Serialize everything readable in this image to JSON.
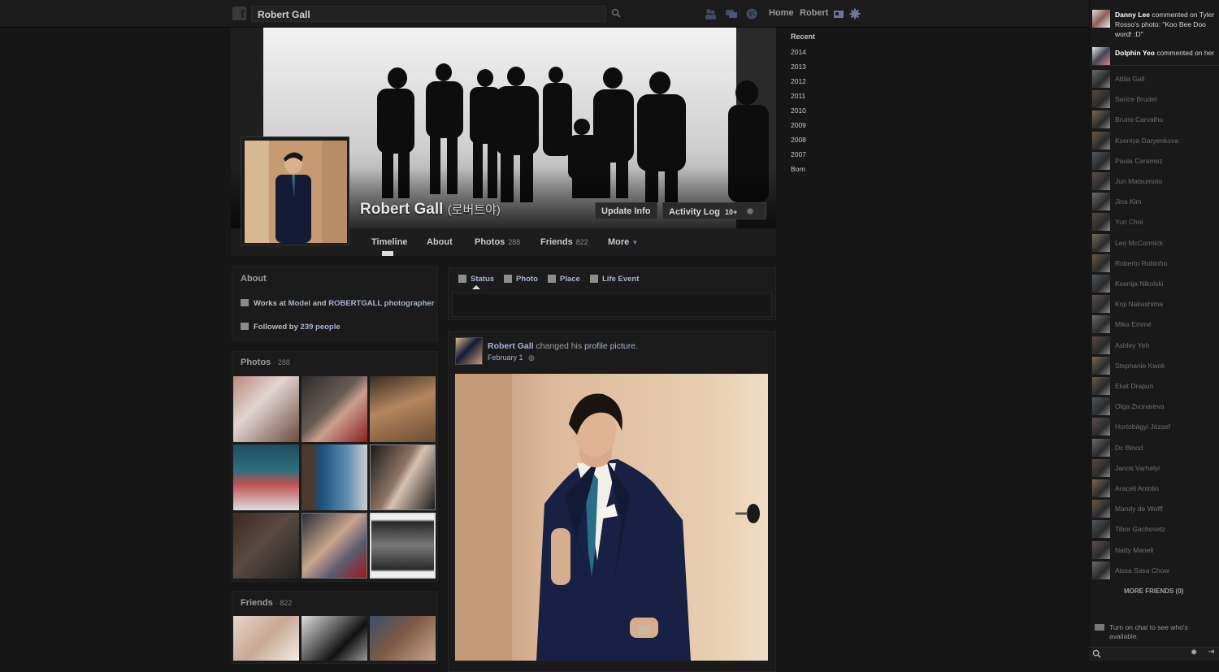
{
  "topbar": {
    "search_value": "Robert Gall",
    "links": [
      "Home",
      "Robert"
    ]
  },
  "cover": {
    "name": "Robert Gall",
    "alt_name": "(로버트야)",
    "update_info": "Update Info",
    "activity_log": "Activity Log",
    "activity_count": "10+"
  },
  "tabs": [
    {
      "label": "Timeline",
      "count": ""
    },
    {
      "label": "About",
      "count": ""
    },
    {
      "label": "Photos",
      "count": "288"
    },
    {
      "label": "Friends",
      "count": "822"
    },
    {
      "label": "More",
      "count": ""
    }
  ],
  "about": {
    "title": "About",
    "works_prefix": "Works at",
    "works_a": "Model",
    "works_and": "and",
    "works_b": "ROBERTGALL photographer",
    "followed_prefix": "Followed by",
    "followed_count": "239 people"
  },
  "photos": {
    "title": "Photos",
    "count": "· 288"
  },
  "friends": {
    "title": "Friends",
    "count": "· 822"
  },
  "composer": {
    "tabs": [
      "Status",
      "Photo",
      "Place",
      "Life Event"
    ]
  },
  "post": {
    "author": "Robert Gall",
    "action": "changed his",
    "object": "profile picture",
    "period": ".",
    "date": "February 1"
  },
  "timeline_years": {
    "recent": "Recent",
    "years": [
      "2014",
      "2013",
      "2012",
      "2011",
      "2010",
      "2009",
      "2008",
      "2007",
      "Born"
    ]
  },
  "ticker": [
    {
      "name": "Danny Lee",
      "text": "commented on Tyler Rosso's photo: \"Koo Bee Doo word! :D\""
    },
    {
      "name": "Dolphin Yeo",
      "text": "commented on her"
    }
  ],
  "chat": {
    "friends": [
      "Attila Gall",
      "Sarice Brudet",
      "Bruno Carvalho",
      "Kseniya Daryenkova",
      "Paula Caramez",
      "Jun Matsumoto",
      "Jina Kim",
      "Yuri Choi",
      "Leo McCormick",
      "Roberto Robinho",
      "Ksenija Nikolski",
      "Koji Nakashima",
      "Mika Emmé",
      "Ashley Yeh",
      "Stephanie Kwok",
      "Ekat Drapun",
      "Olga Zvonareva",
      "Hortobágyi József",
      "Dc Binod",
      "Janos Varhelyi",
      "Araceli Antolin",
      "Mandy de Wolff",
      "Tibor Gachovetz",
      "Natty Manell",
      "Aissa Sasa Chow"
    ],
    "more_friends": "MORE FRIENDS (0)",
    "turn_on": "Turn on chat to see who's available."
  }
}
